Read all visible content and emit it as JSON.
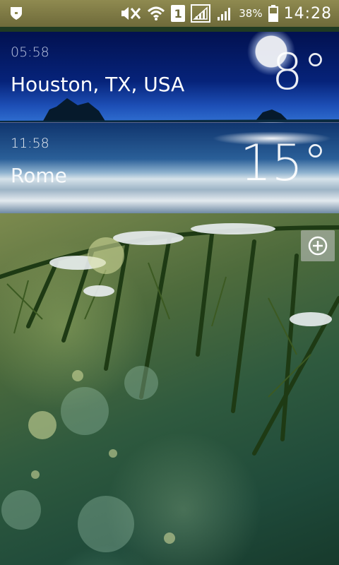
{
  "status_bar": {
    "battery_percent": "38%",
    "time": "14:28",
    "sim_slot": "1",
    "icons": [
      "shield-icon",
      "mute-icon",
      "wifi-icon",
      "sim-icon",
      "signal-icon",
      "signal-icon",
      "battery-icon"
    ]
  },
  "cities": [
    {
      "time": "05:58",
      "name": "Houston, TX, USA",
      "temp": "8°",
      "condition": "clear-night"
    },
    {
      "time": "11:58",
      "name": "Rome",
      "temp": "15°",
      "condition": "sunny"
    }
  ],
  "add_button": {
    "icon": "plus-circle-icon"
  },
  "colors": {
    "status_bar": "#8f8a50",
    "night_sky": "#06237a",
    "day_sky": "#2a5f98"
  }
}
